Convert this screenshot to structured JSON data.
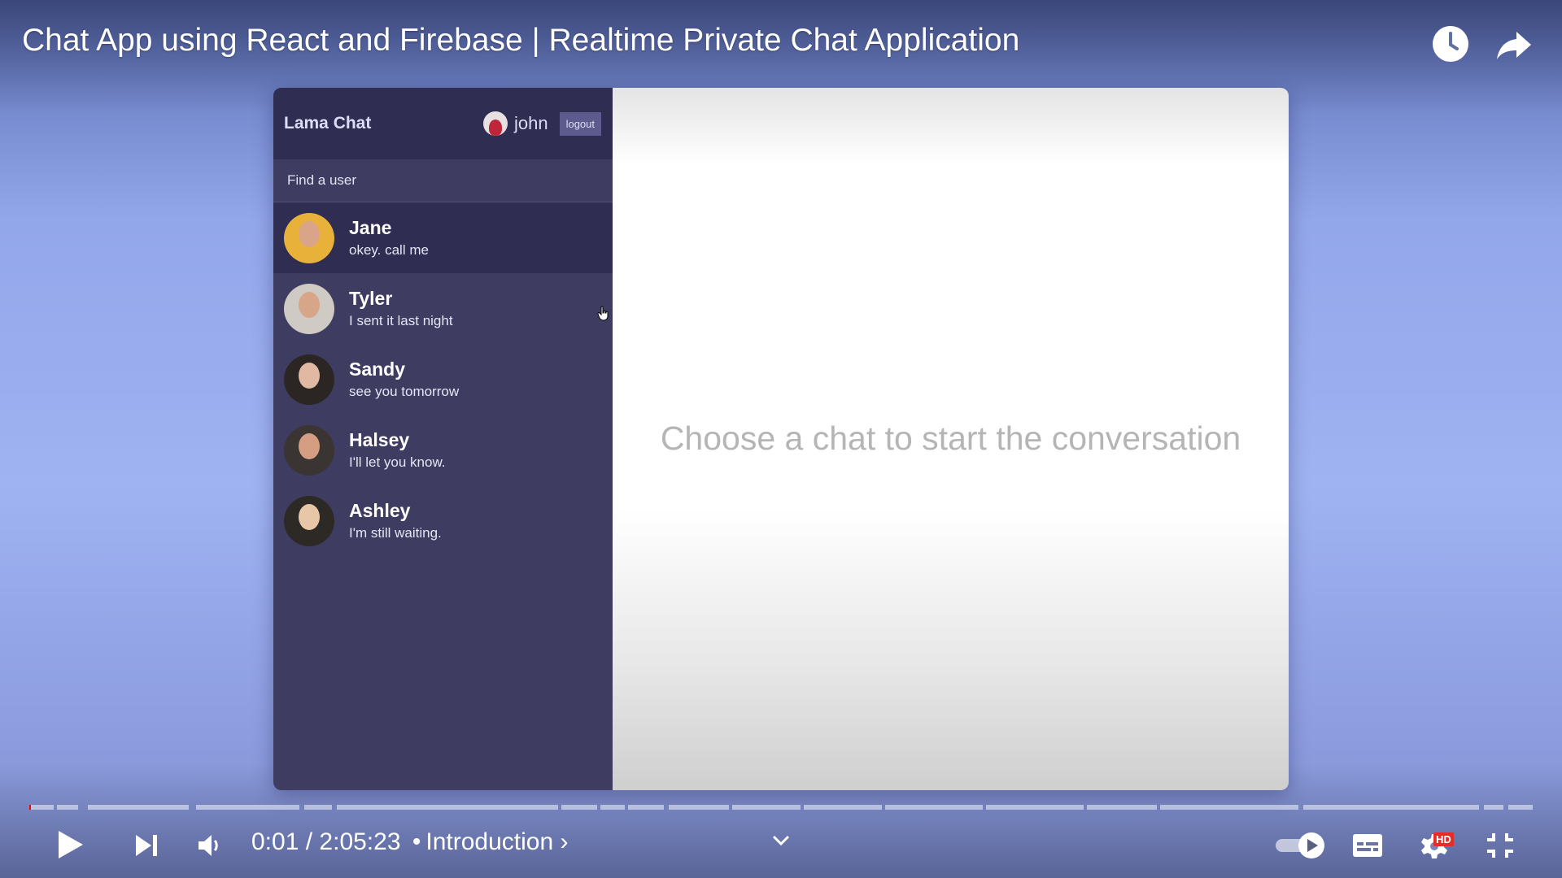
{
  "player": {
    "title": "Chat App using React and Firebase | Realtime Private Chat Application",
    "current_time": "0:01",
    "duration": "2:05:23",
    "time_separator": "/",
    "chapter_separator": "•",
    "chapter": "Introduction",
    "chapter_chevron": "›",
    "progress_fraction": 0.0001,
    "hd_badge": "HD",
    "icons": {
      "watch_later": "clock-icon",
      "share": "share-icon",
      "play": "play-icon",
      "next": "next-icon",
      "volume": "volume-icon",
      "chapter_dropdown": "chevron-down-icon",
      "autoplay": "autoplay-toggle-icon",
      "subtitles": "subtitles-icon",
      "settings": "settings-icon",
      "exit_fullscreen": "exit-fullscreen-icon"
    }
  },
  "app": {
    "logo": "Lama Chat",
    "current_user": {
      "name": "john"
    },
    "logout_label": "logout",
    "search": {
      "placeholder": "Find a user",
      "value": ""
    },
    "chats": [
      {
        "name": "Jane",
        "last_message": "okey. call me",
        "active": true,
        "avatar_bg": "#e8b23a",
        "avatar_face": "#d9a48a"
      },
      {
        "name": "Tyler",
        "last_message": "I sent it last night",
        "active": false,
        "avatar_bg": "#cfcac4",
        "avatar_face": "#d7a588"
      },
      {
        "name": "Sandy",
        "last_message": "see you tomorrow",
        "active": false,
        "avatar_bg": "#2b2623",
        "avatar_face": "#e1b9a3"
      },
      {
        "name": "Halsey",
        "last_message": "I'll let you know.",
        "active": false,
        "avatar_bg": "#3a3432",
        "avatar_face": "#d59e83"
      },
      {
        "name": "Ashley",
        "last_message": "I'm still waiting.",
        "active": false,
        "avatar_bg": "#2d2a25",
        "avatar_face": "#e8c7a8"
      }
    ],
    "empty_state": "Choose a chat to start the conversation"
  }
}
